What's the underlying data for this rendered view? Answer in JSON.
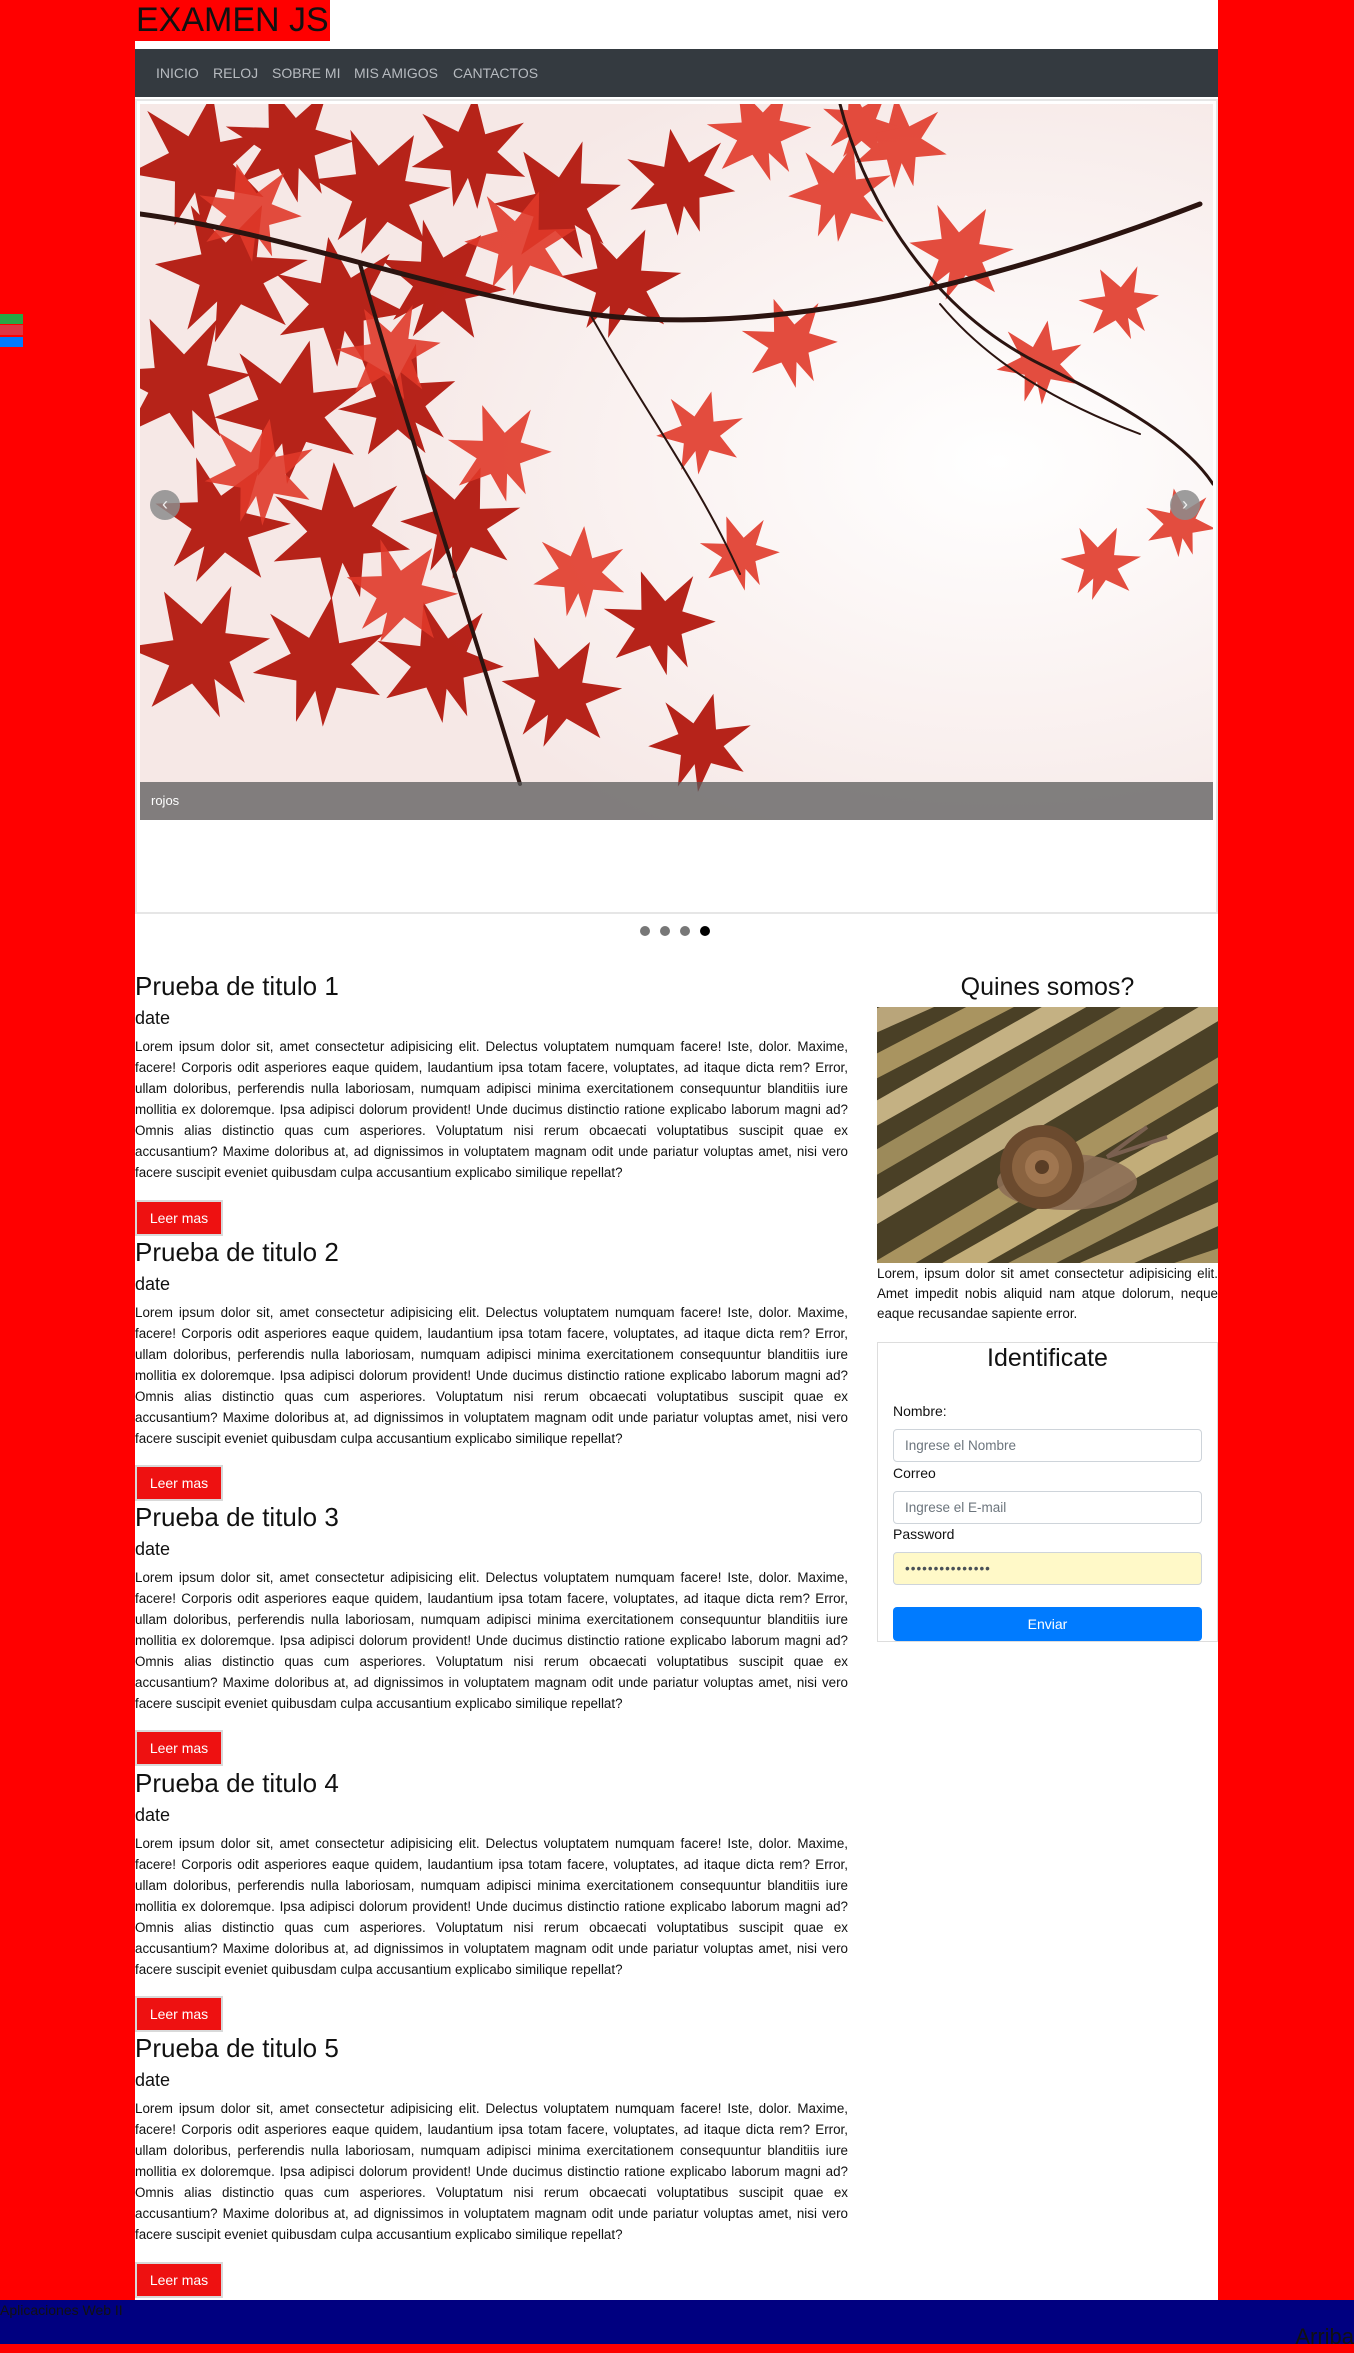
{
  "header": {
    "title": "EXAMEN JS"
  },
  "nav": {
    "items": [
      "INICIO",
      "RELOJ",
      "SOBRE MI",
      "MIS AMIGOS",
      "CANTACTOS"
    ]
  },
  "carousel": {
    "caption": "rojos",
    "prev_icon": "chevron-left-icon",
    "next_icon": "chevron-right-icon",
    "prev_glyph": "‹",
    "next_glyph": "›",
    "slide_count": 4,
    "active_slide": 4
  },
  "posts": [
    {
      "title": "Prueba de titulo 1",
      "date": "date",
      "body": "Lorem ipsum dolor sit, amet consectetur adipisicing elit. Delectus voluptatem numquam facere! Iste, dolor. Maxime, facere! Corporis odit asperiores eaque quidem, laudantium ipsa totam facere, voluptates, ad itaque dicta rem? Error, ullam doloribus, perferendis nulla laboriosam, numquam adipisci minima exercitationem consequuntur blanditiis iure mollitia ex doloremque. Ipsa adipisci dolorum provident! Unde ducimus distinctio ratione explicabo laborum magni ad? Omnis alias distinctio quas cum asperiores. Voluptatum nisi rerum obcaecati voluptatibus suscipit quae ex accusantium? Maxime doloribus at, ad dignissimos in voluptatem magnam odit unde pariatur voluptas amet, nisi vero facere suscipit eveniet quibusdam culpa accusantium explicabo similique repellat?",
      "button": "Leer mas"
    },
    {
      "title": "Prueba de titulo 2",
      "date": "date",
      "body": "Lorem ipsum dolor sit, amet consectetur adipisicing elit. Delectus voluptatem numquam facere! Iste, dolor. Maxime, facere! Corporis odit asperiores eaque quidem, laudantium ipsa totam facere, voluptates, ad itaque dicta rem? Error, ullam doloribus, perferendis nulla laboriosam, numquam adipisci minima exercitationem consequuntur blanditiis iure mollitia ex doloremque. Ipsa adipisci dolorum provident! Unde ducimus distinctio ratione explicabo laborum magni ad? Omnis alias distinctio quas cum asperiores. Voluptatum nisi rerum obcaecati voluptatibus suscipit quae ex accusantium? Maxime doloribus at, ad dignissimos in voluptatem magnam odit unde pariatur voluptas amet, nisi vero facere suscipit eveniet quibusdam culpa accusantium explicabo similique repellat?",
      "button": "Leer mas"
    },
    {
      "title": "Prueba de titulo 3",
      "date": "date",
      "body": "Lorem ipsum dolor sit, amet consectetur adipisicing elit. Delectus voluptatem numquam facere! Iste, dolor. Maxime, facere! Corporis odit asperiores eaque quidem, laudantium ipsa totam facere, voluptates, ad itaque dicta rem? Error, ullam doloribus, perferendis nulla laboriosam, numquam adipisci minima exercitationem consequuntur blanditiis iure mollitia ex doloremque. Ipsa adipisci dolorum provident! Unde ducimus distinctio ratione explicabo laborum magni ad? Omnis alias distinctio quas cum asperiores. Voluptatum nisi rerum obcaecati voluptatibus suscipit quae ex accusantium? Maxime doloribus at, ad dignissimos in voluptatem magnam odit unde pariatur voluptas amet, nisi vero facere suscipit eveniet quibusdam culpa accusantium explicabo similique repellat?",
      "button": "Leer mas"
    },
    {
      "title": "Prueba de titulo 4",
      "date": "date",
      "body": "Lorem ipsum dolor sit, amet consectetur adipisicing elit. Delectus voluptatem numquam facere! Iste, dolor. Maxime, facere! Corporis odit asperiores eaque quidem, laudantium ipsa totam facere, voluptates, ad itaque dicta rem? Error, ullam doloribus, perferendis nulla laboriosam, numquam adipisci minima exercitationem consequuntur blanditiis iure mollitia ex doloremque. Ipsa adipisci dolorum provident! Unde ducimus distinctio ratione explicabo laborum magni ad? Omnis alias distinctio quas cum asperiores. Voluptatum nisi rerum obcaecati voluptatibus suscipit quae ex accusantium? Maxime doloribus at, ad dignissimos in voluptatem magnam odit unde pariatur voluptas amet, nisi vero facere suscipit eveniet quibusdam culpa accusantium explicabo similique repellat?",
      "button": "Leer mas"
    },
    {
      "title": "Prueba de titulo 5",
      "date": "date",
      "body": "Lorem ipsum dolor sit, amet consectetur adipisicing elit. Delectus voluptatem numquam facere! Iste, dolor. Maxime, facere! Corporis odit asperiores eaque quidem, laudantium ipsa totam facere, voluptates, ad itaque dicta rem? Error, ullam doloribus, perferendis nulla laboriosam, numquam adipisci minima exercitationem consequuntur blanditiis iure mollitia ex doloremque. Ipsa adipisci dolorum provident! Unde ducimus distinctio ratione explicabo laborum magni ad? Omnis alias distinctio quas cum asperiores. Voluptatum nisi rerum obcaecati voluptatibus suscipit quae ex accusantium? Maxime doloribus at, ad dignissimos in voluptatem magnam odit unde pariatur voluptas amet, nisi vero facere suscipit eveniet quibusdam culpa accusantium explicabo similique repellat?",
      "button": "Leer mas"
    }
  ],
  "sidebar": {
    "about_title": "Quines somos?",
    "about_text": "Lorem, ipsum dolor sit amet consectetur adipisicing elit. Amet impedit nobis aliquid nam atque dolorum, neque eaque recusandae sapiente error."
  },
  "login": {
    "title": "Identificate",
    "name_label": "Nombre:",
    "name_placeholder": "Ingrese el Nombre",
    "email_label": "Correo",
    "email_placeholder": "Ingrese el E-mail",
    "password_label": "Password",
    "password_value": "•••••••••••••••",
    "submit": "Enviar"
  },
  "footer": {
    "text": "Aplicaciones Web II",
    "up_link": "Arriba"
  },
  "colors": {
    "page_bg": "#ff0000",
    "navbar": "#343a40",
    "button": "#ee1111",
    "submit": "#007bff",
    "footer": "#000080"
  }
}
